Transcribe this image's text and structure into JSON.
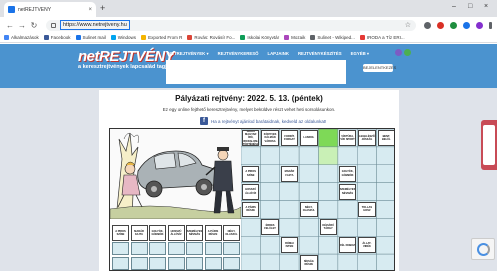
{
  "browser": {
    "tab_title": "netREJTVÉNY",
    "tab_close": "×",
    "new_tab": "+",
    "window_controls": [
      "–",
      "□",
      "×"
    ],
    "url": "https://www.netrejtveny.hu",
    "nav": {
      "back": "←",
      "forward": "→",
      "reload": "↻"
    },
    "star": "☆",
    "extensions": [
      "#5f6368",
      "#d93025",
      "#1e8e3e",
      "#1a73e8",
      "#8430ce",
      "#5f6368"
    ],
    "bookmarks": [
      {
        "label": "Alkalmazások",
        "color": "#4285f4"
      },
      {
        "label": "Facebook",
        "color": "#3b5998"
      },
      {
        "label": "Sulinet mail",
        "color": "#1a73e8"
      },
      {
        "label": "Windows",
        "color": "#00a4ef"
      },
      {
        "label": "Exported From R",
        "color": "#f4b400"
      },
      {
        "label": "Rovás: Rovásír Fo...",
        "color": "#db4437"
      },
      {
        "label": "Iskolai Könyvtár",
        "color": "#0f9d58"
      },
      {
        "label": "Mozaik",
        "color": "#ab47bc"
      },
      {
        "label": "Sulinet - Wikiped...",
        "color": "#5f6368"
      },
      {
        "label": "IRODA a Tíz ERI...",
        "color": "#e53935"
      }
    ]
  },
  "site": {
    "logo": "netREJTVÉNY",
    "tagline": "a keresztrejtvények lapcsalád tagja",
    "nav": [
      "NETREJTVÉNYEK ▾",
      "REJTVÉNYKERESŐ",
      "LAPJAINK",
      "REJTVÉNYKÉSZÍTÉS",
      "EGYÉB ▾"
    ],
    "nav_circle_colors": [
      "#7c5cc4",
      "#4caf50"
    ],
    "login_label": "BEJELENTKEZÉS"
  },
  "main": {
    "title": "Pályázati rejtvény: 2022. 5. 13. (péntek)",
    "description": "Ez egy online fejthető keresztrejtvény, melyet beküldve részt vehet heti sorsolásunkon.",
    "facebook_icon": "f",
    "facebook_text": "Ha a rejtvényt ajánlod barátaidnak, kedveld az oldalunkat!"
  },
  "puzzle": {
    "clues": [
      {
        "text": "SÍRÓS MAGYAR ÍRÓ, IRODALOM-TÖRTÉNÉSZ"
      },
      {
        "text": "KÖNYVES KÁLMÁN VÁROSA"
      },
      {
        "text": "FORDÍT, FORGAT"
      },
      {
        "text": "LANDOL"
      },
      {
        "text": "VÍZITÚRA, VÍZI SPORT"
      },
      {
        "text": "LEGELÉSZŐ JÓSZÁG"
      },
      {
        "text": "BENT, BELÜL"
      },
      {
        "text": "A PIROS SZÍNE"
      },
      {
        "text": "MADÁR FAJTA"
      },
      {
        "text": "GOLYÓK, GÖMBÖK"
      },
      {
        "text": "HOSSZÚ ÁLLÓVÍZ"
      },
      {
        "text": "SZEMÉLYES NÉVMÁS"
      },
      {
        "text": "A PÁRIS RÉSZE"
      },
      {
        "text": "NÉGY, OLASZUL"
      },
      {
        "text": "TOLLAS HOSZ"
      },
      {
        "text": "ÉRDES FELÜLET"
      },
      {
        "text": "KÉZIÁRÚ TÁRGY"
      },
      {
        "text": "RÓMAI ISTEN"
      },
      {
        "text": "FÉL DOBOZ"
      },
      {
        "text": "ÁLLAT-VIDÉK"
      },
      {
        "text": "SÍKSÁG RÉSZE"
      }
    ]
  },
  "widgets": {
    "side_tab_color": "#c84b56"
  }
}
